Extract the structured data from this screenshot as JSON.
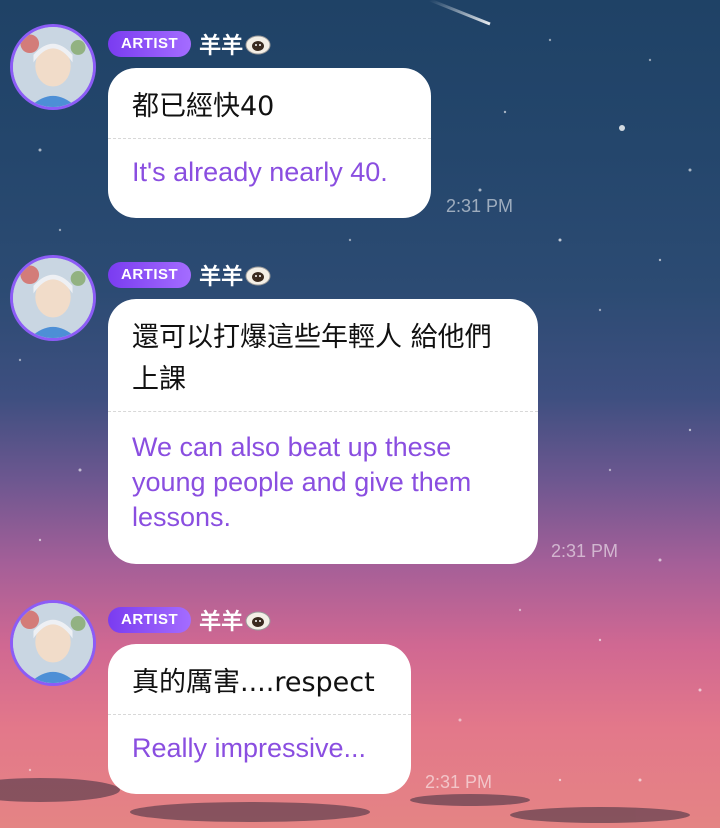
{
  "messages": [
    {
      "badge": "ARTIST",
      "sender": "羊羊",
      "sender_icon": "sheep-icon",
      "original": "都已經快40",
      "translation": "It's already nearly 40.",
      "time": "2:31 PM"
    },
    {
      "badge": "ARTIST",
      "sender": "羊羊",
      "sender_icon": "sheep-icon",
      "original": "還可以打爆這些年輕人 給他們上課",
      "translation": "We can also beat up these young people and give them lessons.",
      "time": "2:31 PM"
    },
    {
      "badge": "ARTIST",
      "sender": "羊羊",
      "sender_icon": "sheep-icon",
      "original": "真的厲害....respect",
      "translation": "Really impressive...",
      "time": "2:31 PM"
    }
  ],
  "colors": {
    "badge": "#8c5cf6",
    "translation_text": "#8a4ee0",
    "avatar_ring": "#8c5cf6"
  }
}
